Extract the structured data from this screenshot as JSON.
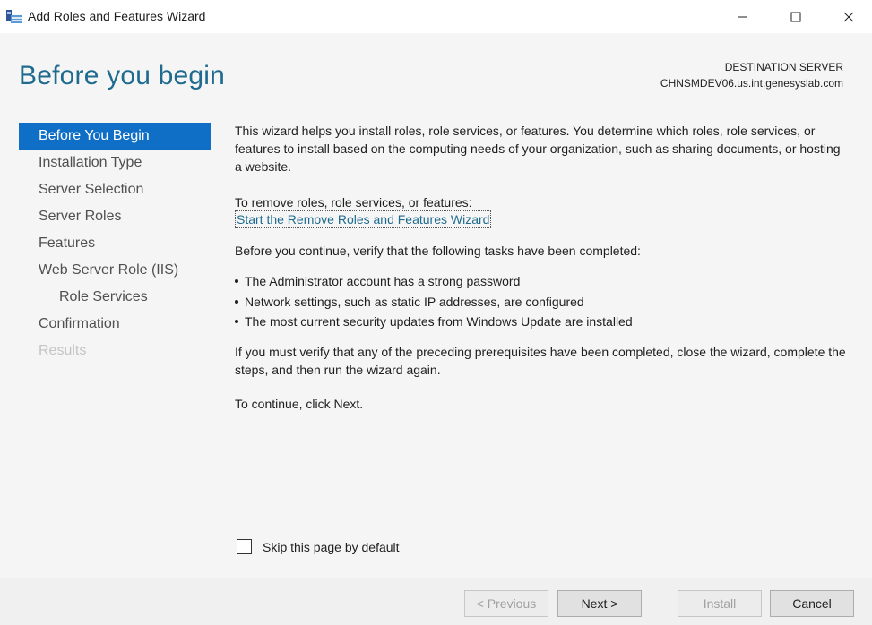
{
  "window": {
    "title": "Add Roles and Features Wizard",
    "icon": "server-manager-icon"
  },
  "header": {
    "heading": "Before you begin",
    "destination_label": "DESTINATION SERVER",
    "destination_server": "CHNSMDEV06.us.int.genesyslab.com"
  },
  "nav": {
    "items": [
      {
        "label": "Before You Begin",
        "state": "active"
      },
      {
        "label": "Installation Type",
        "state": "normal"
      },
      {
        "label": "Server Selection",
        "state": "normal"
      },
      {
        "label": "Server Roles",
        "state": "normal"
      },
      {
        "label": "Features",
        "state": "normal"
      },
      {
        "label": "Web Server Role (IIS)",
        "state": "normal"
      },
      {
        "label": "Role Services",
        "state": "sub"
      },
      {
        "label": "Confirmation",
        "state": "normal"
      },
      {
        "label": "Results",
        "state": "disabled"
      }
    ]
  },
  "content": {
    "intro": "This wizard helps you install roles, role services, or features. You determine which roles, role services, or features to install based on the computing needs of your organization, such as sharing documents, or hosting a website.",
    "remove_text": "To remove roles, role services, or features:",
    "remove_link": "Start the Remove Roles and Features Wizard",
    "verify_text": "Before you continue, verify that the following tasks have been completed:",
    "bullets": [
      "The Administrator account has a strong password",
      "Network settings, such as static IP addresses, are configured",
      "The most current security updates from Windows Update are installed"
    ],
    "prereq_text": "If you must verify that any of the preceding prerequisites have been completed, close the wizard, complete the steps, and then run the wizard again.",
    "continue_text": "To continue, click Next."
  },
  "skip": {
    "label": "Skip this page by default",
    "checked": false
  },
  "buttons": {
    "previous": "< Previous",
    "next": "Next >",
    "install": "Install",
    "cancel": "Cancel"
  },
  "colors": {
    "accent": "#0f6fc6",
    "heading": "#1f6b8f",
    "link": "#1f6b8f"
  }
}
